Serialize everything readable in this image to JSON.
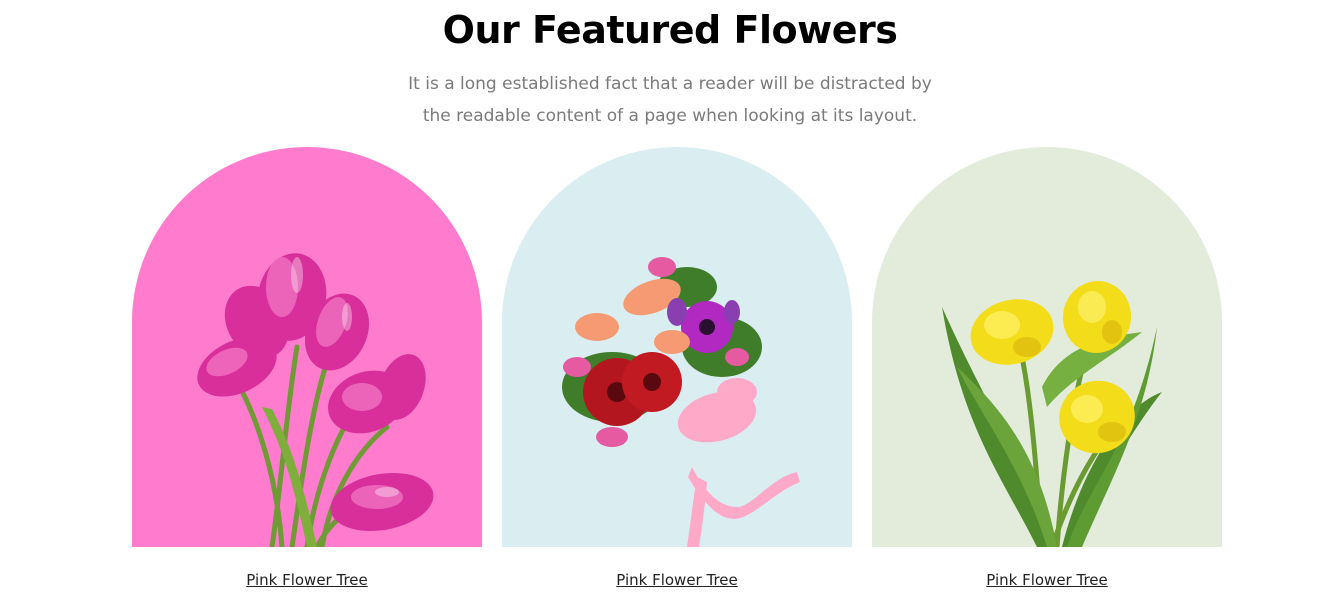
{
  "section": {
    "title": "Our Featured Flowers",
    "subtitle_line1": "It is a long established fact that a reader will be distracted by",
    "subtitle_line2": "the readable content of a page when looking at its layout."
  },
  "cards": [
    {
      "label": "Pink Flower Tree",
      "background": "#ff7bce",
      "image": "pink-tulips-image"
    },
    {
      "label": "Pink Flower Tree",
      "background": "#daeef2",
      "image": "mixed-bouquet-image"
    },
    {
      "label": "Pink Flower Tree",
      "background": "#e3ebdb",
      "image": "yellow-tulips-image"
    }
  ],
  "colors": {
    "heading": "#000000",
    "subtitle": "#7a7a7a",
    "link": "#222222"
  }
}
